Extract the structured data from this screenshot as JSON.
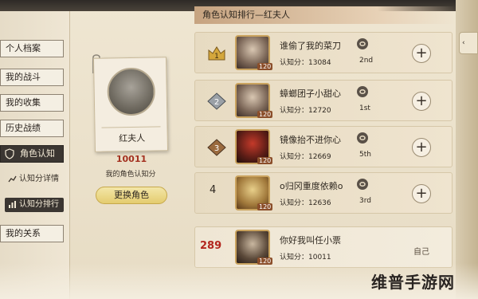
{
  "sidebar": {
    "items": [
      {
        "label": "个人档案"
      },
      {
        "label": "我的战斗"
      },
      {
        "label": "我的收集"
      },
      {
        "label": "历史战绩"
      },
      {
        "label": "角色认知"
      },
      {
        "label": "认知分详情"
      },
      {
        "label": "认知分排行"
      },
      {
        "label": "我的关系"
      }
    ]
  },
  "profile": {
    "character_name": "红夫人",
    "score": "10011",
    "score_label": "我的角色认知分",
    "change_button": "更换角色"
  },
  "ranking": {
    "title": "角色认知排行—红夫人",
    "rows": [
      {
        "rank": "1",
        "name": "谁偷了我的菜刀",
        "score_text": "认知分：13084",
        "season": "2nd",
        "level": "120"
      },
      {
        "rank": "2",
        "name": "蟑螂团子小甜心",
        "score_text": "认知分：12720",
        "season": "1st",
        "level": "120"
      },
      {
        "rank": "3",
        "name": "镜像抬不进你心",
        "score_text": "认知分：12669",
        "season": "5th",
        "level": "120"
      },
      {
        "rank": "4",
        "name": "o归冈重度依赖o",
        "score_text": "认知分：12636",
        "season": "3rd",
        "level": "120"
      }
    ],
    "self_row": {
      "rank": "289",
      "name": "你好我叫任小票",
      "score_text": "认知分：10011",
      "level": "120",
      "self_label": "自己"
    }
  },
  "watermark": "维普手游网",
  "colors": {
    "accent_dark": "#3b3632",
    "gold_button": "#e4cc6f",
    "rank_red": "#b3261e"
  }
}
